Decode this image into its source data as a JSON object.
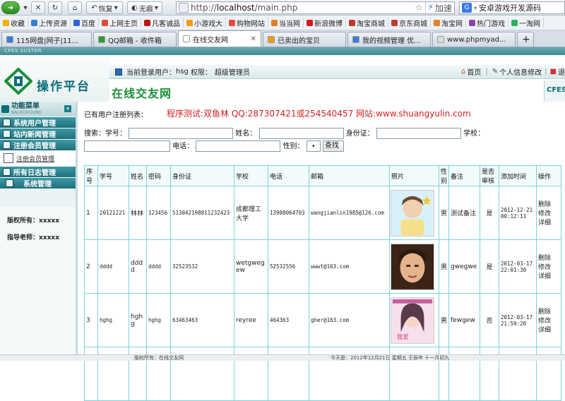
{
  "browser": {
    "back_dropdown": "▾",
    "restore_label": "恢复",
    "traceless_label": "无痕",
    "url_scheme": "http://",
    "url_host": "localhost",
    "url_path": "/main.php",
    "accelerate_label": "加速",
    "search_text": "安卓游戏开发源码",
    "bookmarks": [
      {
        "label": "收藏",
        "color": "#f0b000"
      },
      {
        "label": "上传资源",
        "color": "#3a7fd5"
      },
      {
        "label": "百度",
        "color": "#2d62d9"
      },
      {
        "label": "上网主页",
        "color": "#e24a3b"
      },
      {
        "label": "凡客诚品",
        "color": "#b11"
      },
      {
        "label": "小游戏大",
        "color": "#f39c12"
      },
      {
        "label": "购物网站",
        "color": "#e74c3c"
      },
      {
        "label": "当当网",
        "color": "#e67e22"
      },
      {
        "label": "新浪微博",
        "color": "#d12"
      },
      {
        "label": "淘宝商城",
        "color": "#c0392b"
      },
      {
        "label": "京东商城",
        "color": "#c0392b"
      },
      {
        "label": "淘宝网",
        "color": "#e67e22"
      },
      {
        "label": "热门游戏",
        "color": "#8e44ad"
      },
      {
        "label": "一淘网",
        "color": "#27ae60"
      }
    ],
    "tabs": [
      {
        "label": "115网盘|网子|11...",
        "color": "#3a7fd5",
        "active": false
      },
      {
        "label": "QQ邮箱 - 收件箱",
        "color": "#2d9c2d",
        "active": false
      },
      {
        "label": "在线交友网",
        "color": "#ffffff",
        "active": true
      },
      {
        "label": "已卖出的宝贝",
        "color": "#f39c12",
        "active": false
      },
      {
        "label": "我的视频管理 优...",
        "color": "#3a7fd5",
        "active": false
      },
      {
        "label": "www.phpmyad...",
        "color": "#ddd",
        "active": false
      }
    ],
    "new_tab": "+"
  },
  "app": {
    "cfes_strip": "CFES SUSTER",
    "logo_title": "操作平台",
    "subtitle": "在线交友网",
    "cfe_badge": "CFES",
    "current_user_label": "当前登录用户：",
    "current_user": "hsg",
    "permission_label": "权限：",
    "permission": "超级管理员",
    "home_link": "首页",
    "profile_link": "个人信息修改",
    "exit_link": "退"
  },
  "sidebar": {
    "title": "功能菜单",
    "title_en": "BACKGROUND",
    "items": [
      {
        "label": "系统用户管理"
      },
      {
        "label": "站内新闻管理"
      },
      {
        "label": "注册会员管理"
      }
    ],
    "sub_item": "注册会员管理",
    "items2": [
      {
        "label": "所有日志管理"
      },
      {
        "label": "系统管理"
      }
    ],
    "copyright": "版权所有：xxxxx",
    "teacher": "指导老师：xxxxx"
  },
  "main": {
    "list_title": "已有用户注册列表：",
    "promo": "程序测试:双鱼林 QQ:287307421或254540457 网站:www.shuangyulin.com",
    "search": {
      "prefix": "搜索：",
      "student_no": "学号：",
      "name": "姓名：",
      "id_card": "身份证：",
      "school": "学校：",
      "phone": "电话：",
      "gender": "性别：",
      "button": "查找"
    },
    "columns": [
      "序号",
      "学号",
      "姓名",
      "密码",
      "身份证",
      "学校",
      "电话",
      "邮箱",
      "照片",
      "性别",
      "备注",
      "是否审核",
      "添加时间",
      "操作"
    ],
    "rows": [
      {
        "no": "1",
        "student_no": "20121221",
        "name": "林林",
        "password": "123456",
        "id_card": "513042198811232423",
        "school": "成都理工大学",
        "phone": "13908064703",
        "email": "wangjianlin1985@126.com",
        "gender": "男",
        "remark": "测试备注",
        "audit": "是",
        "time": "2012-12-21 00:12:11"
      },
      {
        "no": "2",
        "student_no": "dddd",
        "name": "dddd",
        "password": "dddd",
        "id_card": "32523532",
        "school": "wetgwegew",
        "phone": "52532556",
        "email": "wwwt@163.com",
        "gender": "男",
        "remark": "gwegwe",
        "audit": "是",
        "time": "2012-03-17 22:01:30"
      },
      {
        "no": "3",
        "student_no": "hghg",
        "name": "hghg",
        "password": "hghg",
        "id_card": "63463463",
        "school": "reyree",
        "phone": "464363",
        "email": "gher@163.com",
        "gender": "男",
        "remark": "fewgew",
        "audit": "否",
        "time": "2012-03-17 21:59:20"
      }
    ],
    "action_delete": "删除",
    "action_edit": "修改",
    "action_detail": "详细"
  },
  "status": {
    "copyright": "版权所有：在线交友网",
    "date": "今天是：2012年12月21日 星期五 壬辰年 十一月初九"
  }
}
